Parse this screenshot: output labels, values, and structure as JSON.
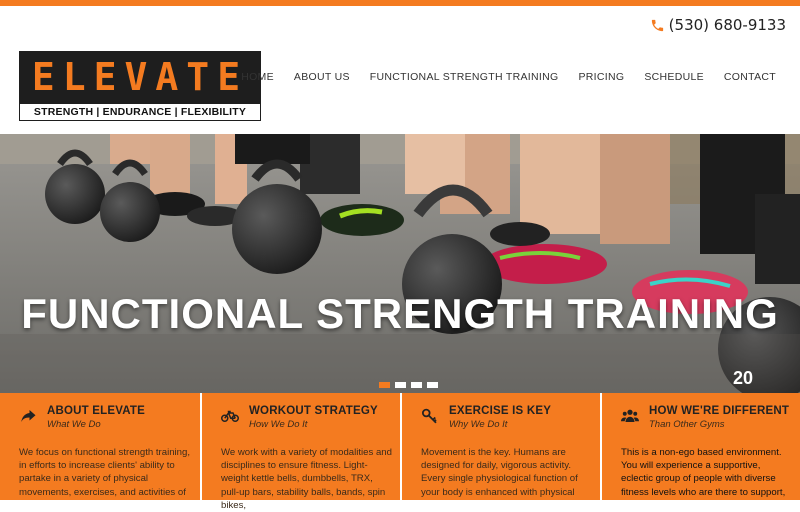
{
  "colors": {
    "accent": "#f47b20",
    "header_bg": "#ffffff",
    "logo_bg": "#1e1e1e"
  },
  "header": {
    "phone": "(530) 680-9133",
    "phone_icon": "phone-icon",
    "logo": {
      "word": "ELEVATE",
      "tagline": "STRENGTH | ENDURANCE | FLEXIBILITY"
    },
    "nav": [
      "HOME",
      "ABOUT US",
      "FUNCTIONAL STRENGTH TRAINING",
      "PRICING",
      "SCHEDULE",
      "CONTACT"
    ]
  },
  "hero": {
    "title": "FUNCTIONAL STRENGTH TRAINING",
    "kettlebell_number": "20",
    "slides": {
      "count": 4,
      "active": 1
    }
  },
  "features": [
    {
      "icon": "share-arrow-icon",
      "title": "ABOUT ELEVATE",
      "subtitle": "What We Do",
      "body": "We focus on functional strength training, in efforts to increase clients' ability to partake in a variety of physical movements, exercises, and activities of"
    },
    {
      "icon": "bicycle-icon",
      "title": "WORKOUT STRATEGY",
      "subtitle": "How We Do It",
      "body": "We work with a variety of modalities and disciplines to ensure fitness. Light-weight kettle bells, dumbbells, TRX, pull-up bars, stability balls, bands, spin bikes,"
    },
    {
      "icon": "key-icon",
      "title": "EXERCISE IS KEY",
      "subtitle": "Why We Do It",
      "body": "Movement is the key. Humans are designed for daily, vigorous activity. Every single physiological function of your body is enhanced with physical"
    },
    {
      "icon": "users-icon",
      "title": "HOW WE'RE DIFFERENT",
      "subtitle": "Than Other Gyms",
      "body": "This is a non-ego based environment. You will experience a supportive, eclectic group of people with diverse fitness levels who are there to support,"
    }
  ]
}
